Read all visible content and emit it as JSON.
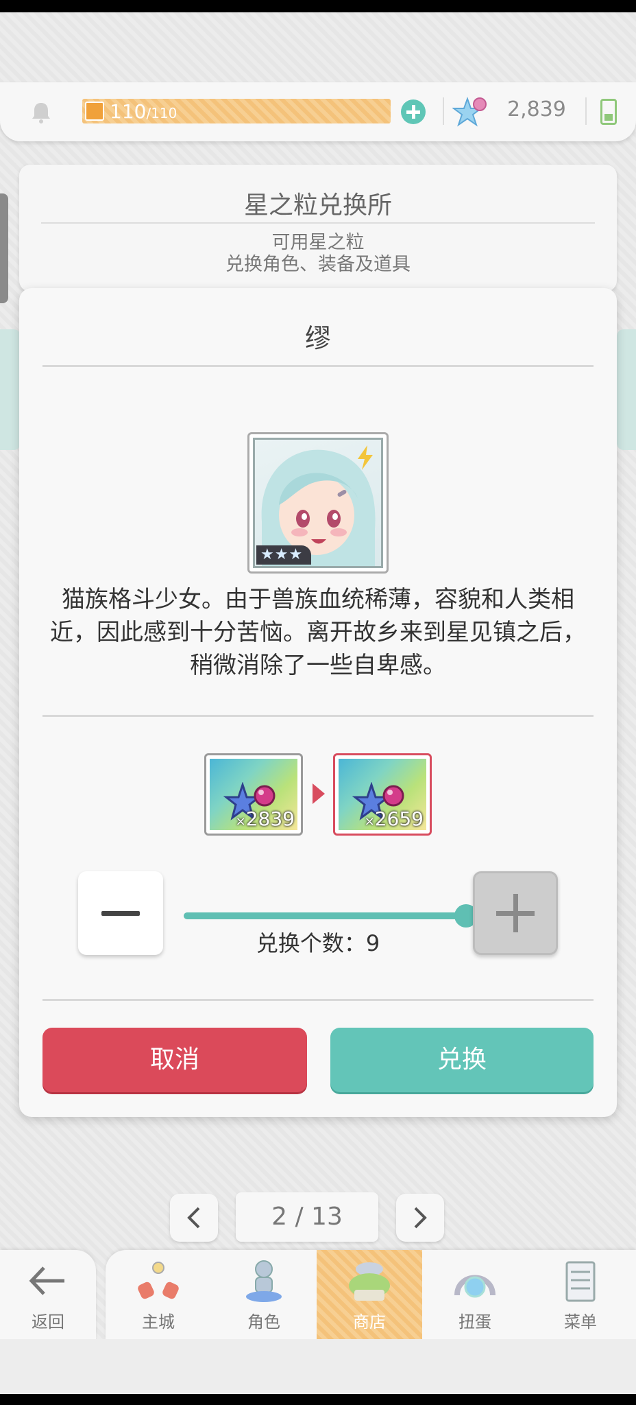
{
  "topbar": {
    "stamina_current": "110",
    "stamina_max": "/110",
    "stars_count": "2,839",
    "icons": [
      "bell-icon",
      "bolt-icon",
      "plus-icon",
      "star-gem-icon",
      "battery-icon"
    ]
  },
  "shop": {
    "title": "星之粒兑换所",
    "subtitle_line1": "可用星之粒",
    "subtitle_line2": "兑换角色、装备及道具"
  },
  "modal": {
    "title": "缪",
    "rarity": "★★★",
    "description": "猫族格斗少女。由于兽族血统稀薄，容貌和人类相近，因此感到十分苦恼。离开故乡来到星见镇之后，稍微消除了一些自卑感。",
    "exchange_from_prefix": "×",
    "exchange_from_count": "2839",
    "exchange_to_prefix": "×",
    "exchange_to_count": "2659",
    "quantity_label": "兑换个数：9",
    "quantity_value": 9,
    "quantity_slider_fraction": 0.98,
    "cancel_label": "取消",
    "confirm_label": "兑换"
  },
  "pagination": {
    "text": "2 / 13"
  },
  "nav": {
    "back_label": "返回",
    "items": [
      {
        "label": "主城",
        "icon": "castle-icon"
      },
      {
        "label": "角色",
        "icon": "character-icon"
      },
      {
        "label": "商店",
        "icon": "shop-icon",
        "active": true
      },
      {
        "label": "扭蛋",
        "icon": "gacha-icon"
      },
      {
        "label": "菜单",
        "icon": "menu-icon"
      }
    ]
  },
  "colors": {
    "accent_teal": "#63c5b8",
    "cancel_red": "#db4a5a",
    "stamina_orange": "#f4c27a"
  }
}
